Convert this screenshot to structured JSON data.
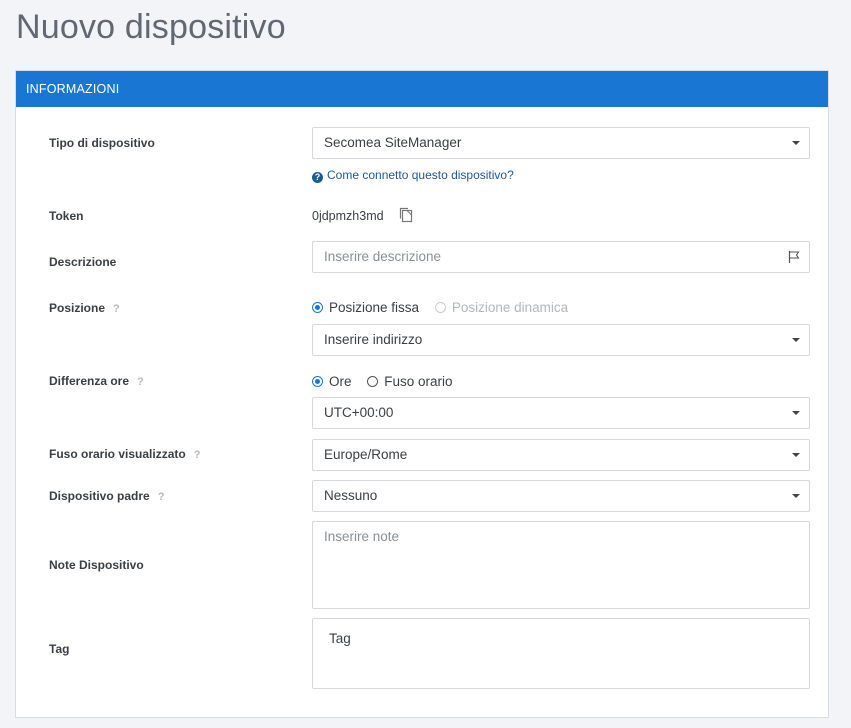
{
  "page": {
    "title": "Nuovo dispositivo"
  },
  "panel": {
    "header": "INFORMAZIONI"
  },
  "form": {
    "tipo": {
      "label": "Tipo di dispositivo",
      "value": "Secomea SiteManager",
      "help": "Come connetto questo dispositivo?"
    },
    "token": {
      "label": "Token",
      "value": "0jdpmzh3md"
    },
    "descrizione": {
      "label": "Descrizione",
      "placeholder": "Inserire descrizione"
    },
    "posizione": {
      "label": "Posizione",
      "q": "?",
      "option_fixed": "Posizione fissa",
      "option_dynamic": "Posizione dinamica",
      "address_placeholder": "Inserire indirizzo"
    },
    "differenza": {
      "label": "Differenza ore",
      "q": "?",
      "option_hours": "Ore",
      "option_tz": "Fuso orario",
      "value": "UTC+00:00"
    },
    "fuso": {
      "label": "Fuso orario visualizzato",
      "q": "?",
      "value": "Europe/Rome"
    },
    "padre": {
      "label": "Dispositivo padre",
      "q": "?",
      "value": "Nessuno"
    },
    "note": {
      "label": "Note Dispositivo",
      "placeholder": "Inserire note"
    },
    "tag": {
      "label": "Tag",
      "placeholder": "Tag"
    }
  },
  "colors": {
    "accent": "#1976d2",
    "link": "#1b5a9a",
    "background": "#f3f4f7"
  }
}
